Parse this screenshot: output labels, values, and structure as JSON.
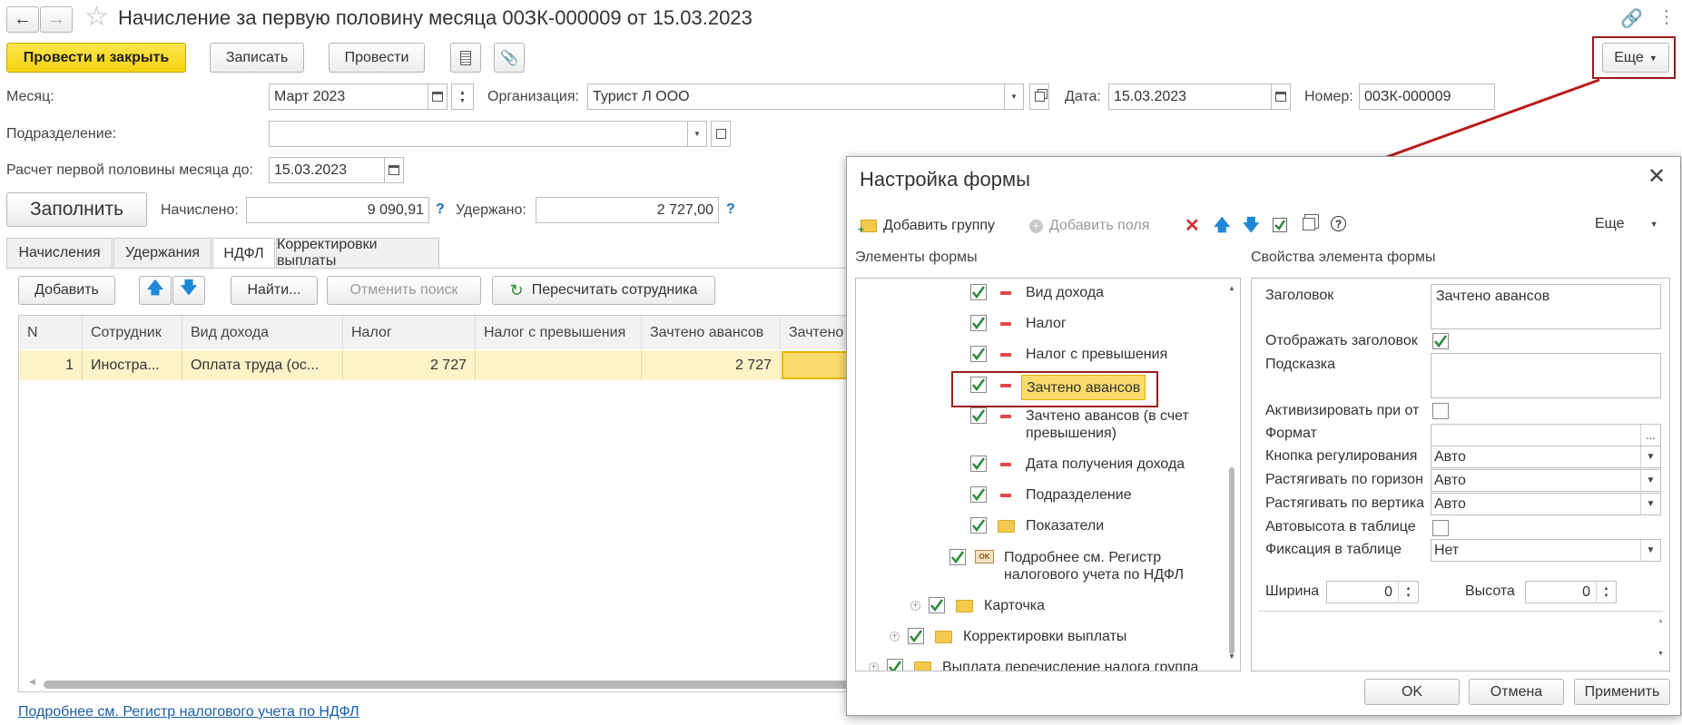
{
  "window": {
    "title": "Начисление за первую половину месяца 00ЗК-000009 от 15.03.2023"
  },
  "toolbar": {
    "post_close": "Провести и закрыть",
    "save": "Записать",
    "post": "Провести",
    "more": "Еще"
  },
  "fields": {
    "month_label": "Месяц:",
    "month_value": "Март 2023",
    "org_label": "Организация:",
    "org_value": "Турист Л ООО",
    "date_label": "Дата:",
    "date_value": "15.03.2023",
    "number_label": "Номер:",
    "number_value": "00ЗК-000009",
    "division_label": "Подразделение:",
    "division_value": "",
    "calc_label": "Расчет первой половины месяца до:",
    "calc_value": "15.03.2023"
  },
  "summary": {
    "fill": "Заполнить",
    "accrued_label": "Начислено:",
    "accrued_value": "9 090,91",
    "withheld_label": "Удержано:",
    "withheld_value": "2 727,00",
    "help": "?"
  },
  "tabs": [
    "Начисления",
    "Удержания",
    "НДФЛ",
    "Корректировки выплаты"
  ],
  "table_toolbar": {
    "add": "Добавить",
    "find": "Найти...",
    "cancel_search": "Отменить поиск",
    "recalc": "Пересчитать сотрудника"
  },
  "table": {
    "columns": [
      "N",
      "Сотрудник",
      "Вид дохода",
      "Налог",
      "Налог с превышения",
      "Зачтено авансов",
      "Зачтено"
    ],
    "rows": [
      [
        "1",
        "Иностра...",
        "Оплата труда (ос...",
        "2 727",
        "",
        "2 727",
        ""
      ]
    ]
  },
  "footer_link": "Подробнее см. Регистр налогового учета по НДФЛ",
  "dialog": {
    "title": "Настройка формы",
    "add_group": "Добавить группу",
    "add_fields": "Добавить поля",
    "more": "Еще",
    "elements_title": "Элементы формы",
    "props_title": "Свойства элемента формы",
    "tree": [
      "Вид дохода",
      "Налог",
      "Налог с превышения",
      "Зачтено авансов",
      "Зачтено авансов (в счет",
      "превышения)",
      "Дата получения дохода",
      "Подразделение",
      "Показатели",
      "Подробнее см. Регистр",
      "налогового учета по НДФЛ",
      "Карточка",
      "Корректировки выплаты",
      "Выплата перечисление налога группа"
    ],
    "props": {
      "caption_label": "Заголовок",
      "caption_value": "Зачтено авансов",
      "show_caption": "Отображать заголовок",
      "hint": "Подсказка",
      "activate": "Активизировать при от",
      "format": "Формат",
      "adjust_button": "Кнопка регулирования",
      "adjust_value": "Авто",
      "stretch_h": "Растягивать по горизон",
      "stretch_h_value": "Авто",
      "stretch_v": "Растягивать по вертика",
      "stretch_v_value": "Авто",
      "autoheight": "Автовысота в таблице",
      "fixation": "Фиксация в таблице",
      "fixation_value": "Нет",
      "width_label": "Ширина",
      "width_value": "0",
      "height_label": "Высота",
      "height_value": "0"
    },
    "ok": "OK",
    "cancel": "Отмена",
    "apply": "Применить"
  },
  "colors": {
    "accent_yellow": "#f5d212",
    "highlight_red": "#9b1c1c",
    "link_blue": "#1a5fa8",
    "check_green": "#2e8b3a"
  }
}
